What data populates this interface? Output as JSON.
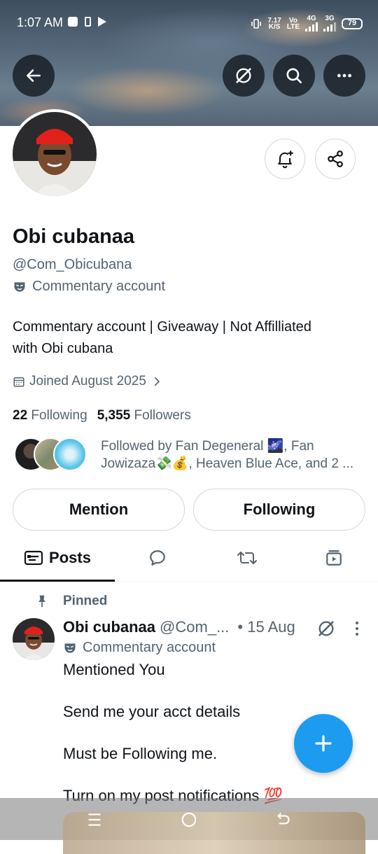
{
  "status_bar": {
    "time": "1:07 AM",
    "net_speed_top": "7.17",
    "net_speed_bottom": "K/S",
    "vo_top": "Vo",
    "vo_bottom": "LTE",
    "sig1_label": "4G",
    "sig2_label": "3G",
    "battery": "79"
  },
  "profile": {
    "name": "Obi cubanaa",
    "handle": "@Com_Obicubana",
    "account_label": "Commentary account",
    "bio_line1": "Commentary account | Giveaway | Not Affilliated",
    "bio_line2": "with Obi cubana",
    "joined": "Joined August 2025",
    "following_count": "22",
    "following_label": "Following",
    "followers_count": "5,355",
    "followers_label": "Followers",
    "followed_by_line1": "Followed by Fan Degeneral 🌌, Fan",
    "followed_by_line2": "Jowizaza💸💰, Heaven Blue Ace, and 2 ..."
  },
  "buttons": {
    "mention": "Mention",
    "following": "Following"
  },
  "tabs": {
    "posts": "Posts"
  },
  "post": {
    "pinned_label": "Pinned",
    "name": "Obi cubanaa",
    "handle": "@Com_...",
    "date": "• 15 Aug",
    "account_label": "Commentary account",
    "lines": [
      "Mentioned You",
      "Send me your acct details",
      "Must be Following me.",
      "Turn on my post notifications 💯"
    ]
  },
  "colors": {
    "accent": "#1d9bf0",
    "text": "#0f1419",
    "muted": "#536471"
  }
}
